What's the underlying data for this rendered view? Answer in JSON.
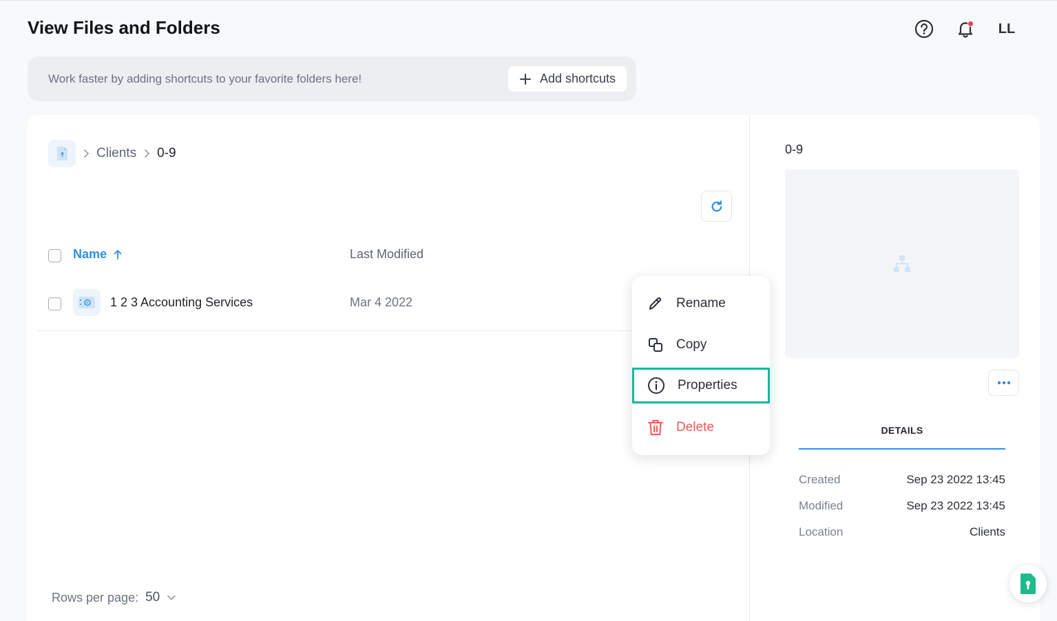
{
  "header": {
    "title": "View Files and Folders",
    "help_icon": "help-circle-icon",
    "notification_icon": "bell-icon",
    "avatar_initials": "LL"
  },
  "shortcuts": {
    "message": "Work faster by adding shortcuts to your favorite folders here!",
    "add_label": "Add shortcuts"
  },
  "breadcrumb": {
    "items": [
      "Clients",
      "0-9"
    ]
  },
  "table": {
    "columns": {
      "name": "Name",
      "last_modified": "Last Modified"
    },
    "sort": {
      "column": "name",
      "direction": "ascending"
    },
    "rows": [
      {
        "name": "1 2 3 Accounting Services",
        "last_modified": "Mar 4 2022"
      }
    ]
  },
  "pagination": {
    "rows_per_page_label": "Rows per page:",
    "rows_per_page_value": "50"
  },
  "context_menu": {
    "items": [
      {
        "label": "Rename",
        "icon": "pencil-icon"
      },
      {
        "label": "Copy",
        "icon": "copy-icon"
      },
      {
        "label": "Properties",
        "icon": "info-icon",
        "highlighted": true
      },
      {
        "label": "Delete",
        "icon": "trash-icon"
      }
    ]
  },
  "side_panel": {
    "title": "0-9",
    "tab": "DETAILS",
    "details": [
      {
        "label": "Created",
        "value": "Sep 23 2022 13:45"
      },
      {
        "label": "Modified",
        "value": "Sep 23 2022 13:45"
      },
      {
        "label": "Location",
        "value": "Clients"
      }
    ]
  },
  "colors": {
    "accent": "#2f8ee0",
    "highlight": "#14b89a",
    "danger": "#ee5a5a",
    "fab": "#1fb98c"
  }
}
